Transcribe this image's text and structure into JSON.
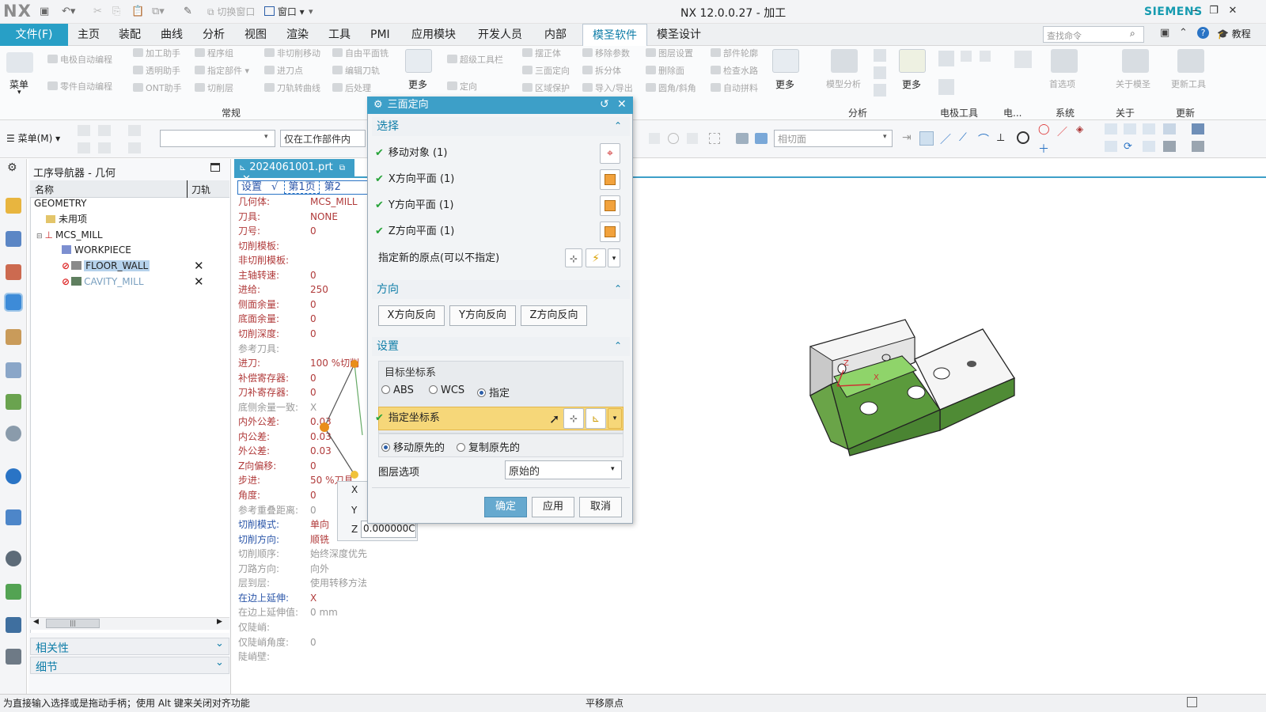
{
  "titlebar": {
    "logo": "NX",
    "quick_access": [
      "切换窗口",
      "窗口"
    ],
    "title": "NX 12.0.0.27 - 加工",
    "brand": "SIEMENS",
    "window_controls": {
      "minimize": "–",
      "restore": "❐",
      "close": "✕"
    }
  },
  "menu": {
    "file": "文件(F)",
    "tabs": [
      "主页",
      "装配",
      "曲线",
      "分析",
      "视图",
      "渲染",
      "工具",
      "PMI",
      "应用模块",
      "开发人员",
      "内部",
      "模圣软件",
      "模圣设计"
    ],
    "active_tab": "模圣软件",
    "search_placeholder": "查找命令",
    "tutorial": "教程"
  },
  "ribbon": {
    "menu_button": "菜单",
    "col1": [
      "电极自动编程",
      "零件自动编程"
    ],
    "col2": [
      "加工助手",
      "透明助手",
      "ONT助手"
    ],
    "col3": [
      "程序组",
      "指定部件",
      "切削层"
    ],
    "col4": [
      "非切削移动",
      "进刀点",
      "刀轨转曲线"
    ],
    "col5": [
      "自由平面铣",
      "编辑刀轨",
      "后处理"
    ],
    "more1": "更多",
    "col6": [
      "超级工具栏",
      "定向"
    ],
    "col7": [
      "摆正体",
      "三面定向",
      "区域保护"
    ],
    "col8": [
      "移除参数",
      "拆分体",
      "导入/导出"
    ],
    "col9": [
      "图层设置",
      "删除面",
      "圆角/斜角"
    ],
    "col10": [
      "部件轮廓",
      "检查水路",
      "自动拼料"
    ],
    "more2": "更多",
    "big_buttons": [
      "模型分析",
      "更多",
      "首选项",
      "关于模圣",
      "更新工具"
    ],
    "groups": [
      "常规",
      "分析",
      "电极工具",
      "电...",
      "系统",
      "关于",
      "更新"
    ]
  },
  "toolbar2": {
    "menu_label": "菜单(M)",
    "filter_combo": "",
    "scope_combo": "仅在工作部件内",
    "snap_combo": "相切面"
  },
  "navigator": {
    "title": "工序导航器 - 几何",
    "col_name": "名称",
    "col_path": "刀轨",
    "items": [
      {
        "label": "GEOMETRY",
        "level": 0
      },
      {
        "label": "未用项",
        "level": 1
      },
      {
        "label": "MCS_MILL",
        "level": 1
      },
      {
        "label": "WORKPIECE",
        "level": 2
      },
      {
        "label": "FLOOR_WALL",
        "level": 2,
        "selected": true,
        "path": "✕"
      },
      {
        "label": "CAVITY_MILL",
        "level": 2,
        "path": "✕"
      }
    ],
    "sections": [
      "相关性",
      "细节"
    ]
  },
  "doc": {
    "tab": "2024061001.prt"
  },
  "info": {
    "tabs": [
      "设置",
      "√",
      "第1页",
      "第2"
    ],
    "rows": [
      {
        "label": "几何体:",
        "value": "MCS_MILL",
        "cls": ""
      },
      {
        "label": "刀具:",
        "value": "NONE",
        "cls": ""
      },
      {
        "label": "刀号:",
        "value": "0",
        "cls": ""
      },
      {
        "label": "切削模板:",
        "value": "",
        "cls": ""
      },
      {
        "label": "非切削模板:",
        "value": "",
        "cls": ""
      },
      {
        "label": "主轴转速:",
        "value": "0",
        "cls": ""
      },
      {
        "label": "进给:",
        "value": "250",
        "cls": ""
      },
      {
        "label": "侧面余量:",
        "value": "0",
        "cls": ""
      },
      {
        "label": "底面余量:",
        "value": "0",
        "cls": ""
      },
      {
        "label": "切削深度:",
        "value": "0",
        "cls": ""
      },
      {
        "label": "参考刀具:",
        "value": "",
        "cls": "gray"
      },
      {
        "label": "进刀:",
        "value": "100   %切削",
        "cls": ""
      },
      {
        "label": "补偿寄存器:",
        "value": "0",
        "cls": ""
      },
      {
        "label": "刀补寄存器:",
        "value": "0",
        "cls": ""
      },
      {
        "label": "底侧余量一致:",
        "value": "X",
        "cls": "gray"
      },
      {
        "label": "内外公差:",
        "value": "0.03",
        "cls": ""
      },
      {
        "label": "内公差:",
        "value": "0.03",
        "cls": ""
      },
      {
        "label": "外公差:",
        "value": "0.03",
        "cls": ""
      },
      {
        "label": "Z向偏移:",
        "value": "0",
        "cls": ""
      },
      {
        "label": "步进:",
        "value": "50   %刀具",
        "cls": ""
      },
      {
        "label": "角度:",
        "value": "0",
        "cls": ""
      },
      {
        "label": "参考重叠距离:",
        "value": "0",
        "cls": "gray"
      },
      {
        "label": "切削模式:",
        "value": "单向",
        "cls": "blue"
      },
      {
        "label": "切削方向:",
        "value": "顺铣",
        "cls": "blue"
      },
      {
        "label": "切削顺序:",
        "value": "始终深度优先",
        "cls": "gray"
      },
      {
        "label": "刀路方向:",
        "value": "向外",
        "cls": "gray"
      },
      {
        "label": "层到层:",
        "value": "使用转移方法",
        "cls": "gray"
      },
      {
        "label": "在边上延伸:",
        "value": "X",
        "cls": "blue"
      },
      {
        "label": "在边上延伸值:",
        "value": "0      mm",
        "cls": "gray"
      },
      {
        "label": "仅陡峭:",
        "value": "",
        "cls": "gray"
      },
      {
        "label": "仅陡峭角度:",
        "value": "0",
        "cls": "gray"
      },
      {
        "label": "陡峭壁:",
        "value": "",
        "cls": "gray"
      }
    ],
    "coord_labels": [
      "X",
      "Y",
      "Z"
    ],
    "coord_z_value": "0.000000C"
  },
  "dialog": {
    "title": "三面定向",
    "sec_select": "选择",
    "rows": [
      "移动对象 (1)",
      "X方向平面 (1)",
      "Y方向平面 (1)",
      "Z方向平面 (1)"
    ],
    "origin_label": "指定新的原点(可以不指定)",
    "sec_direction": "方向",
    "dir_buttons": [
      "X方向反向",
      "Y方向反向",
      "Z方向反向"
    ],
    "sec_settings": "设置",
    "target_cs": "目标坐标系",
    "cs_options": [
      "ABS",
      "WCS",
      "指定"
    ],
    "cs_selected": "指定",
    "specify_cs": "指定坐标系",
    "move_options": [
      "移动原先的",
      "复制原先的"
    ],
    "layer_label": "图层选项",
    "layer_value": "原始的",
    "ok": "确定",
    "apply": "应用",
    "cancel": "取消"
  },
  "status": {
    "left": "为直接输入选择或是拖动手柄；使用 Alt 键来关闭对齐功能",
    "center": "平移原点"
  },
  "colors": {
    "accent": "#3d9fc8",
    "file_tab": "#289fc6",
    "part_green": "#5b9a3c",
    "highlight": "#f6d779"
  }
}
